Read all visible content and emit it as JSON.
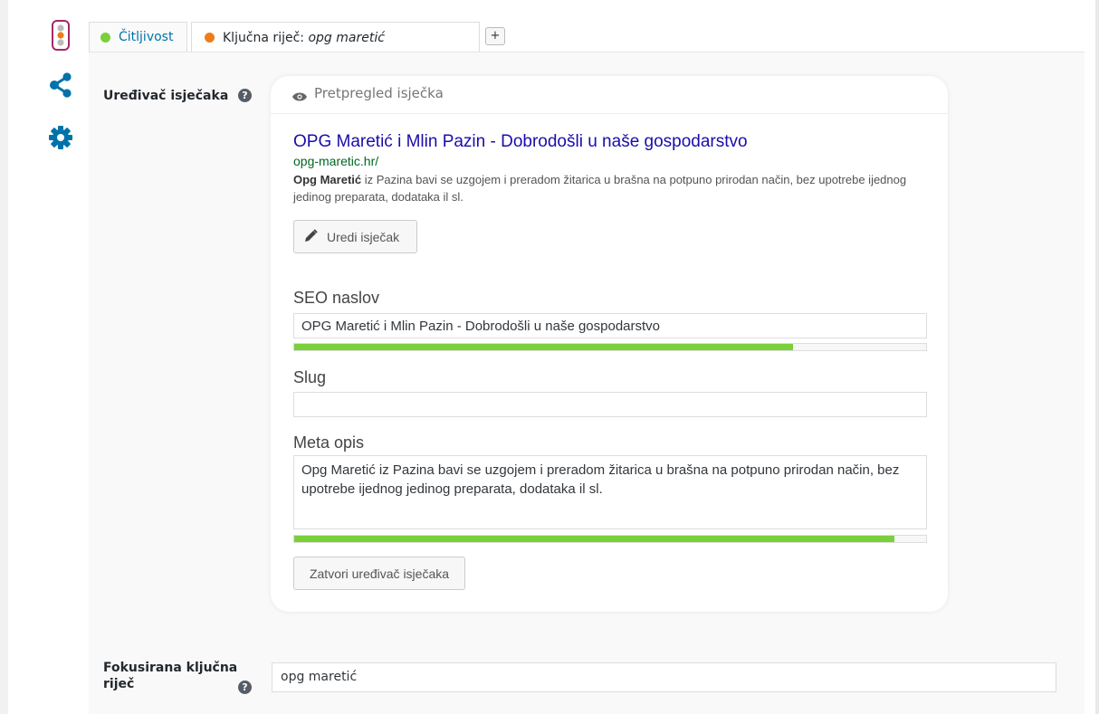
{
  "colors": {
    "good": "#7ad03a",
    "ok": "#ee7c1b",
    "link": "#1a0dab",
    "url": "#006621",
    "tab_link": "#0073aa"
  },
  "sidebar": {
    "icons": [
      "traffic-light-icon",
      "share-icon",
      "gear-icon"
    ]
  },
  "tabs": {
    "readability": {
      "label": "Čitljivost",
      "status_color": "#7ad03a"
    },
    "keyword": {
      "label_prefix": "Ključna riječ: ",
      "label_value": "opg maretić",
      "status_color": "#ee7c1b"
    },
    "add_label": "+"
  },
  "snippet_editor": {
    "label": "Uređivač isječaka",
    "help": "?",
    "preview_label": "Pretpregled isječka",
    "preview": {
      "title": "OPG Maretić i Mlin Pazin - Dobrodošli u naše gospodarstvo",
      "url": "opg-maretic.hr/",
      "desc_bold": "Opg Maretić",
      "desc_rest": " iz Pazina bavi se uzgojem i preradom žitarica u brašna na potpuno prirodan način, bez upotrebe ijednog jedinog preparata, dodataka il sl."
    },
    "edit_button": "Uredi isječak",
    "seo_title": {
      "label": "SEO naslov",
      "value": "OPG Maretić i Mlin Pazin - Dobrodošli u naše gospodarstvo",
      "progress": 0.79
    },
    "slug": {
      "label": "Slug",
      "value": ""
    },
    "meta": {
      "label": "Meta opis",
      "value": "Opg Maretić iz Pazina bavi se uzgojem i preradom žitarica u brašna na potpuno prirodan način, bez upotrebe ijednog jedinog preparata, dodataka il sl.",
      "progress": 0.95
    },
    "close_button": "Zatvori uređivač isječaka"
  },
  "focus_keyword": {
    "label": "Fokusirana ključna riječ",
    "help": "?",
    "value": "opg maretić"
  }
}
